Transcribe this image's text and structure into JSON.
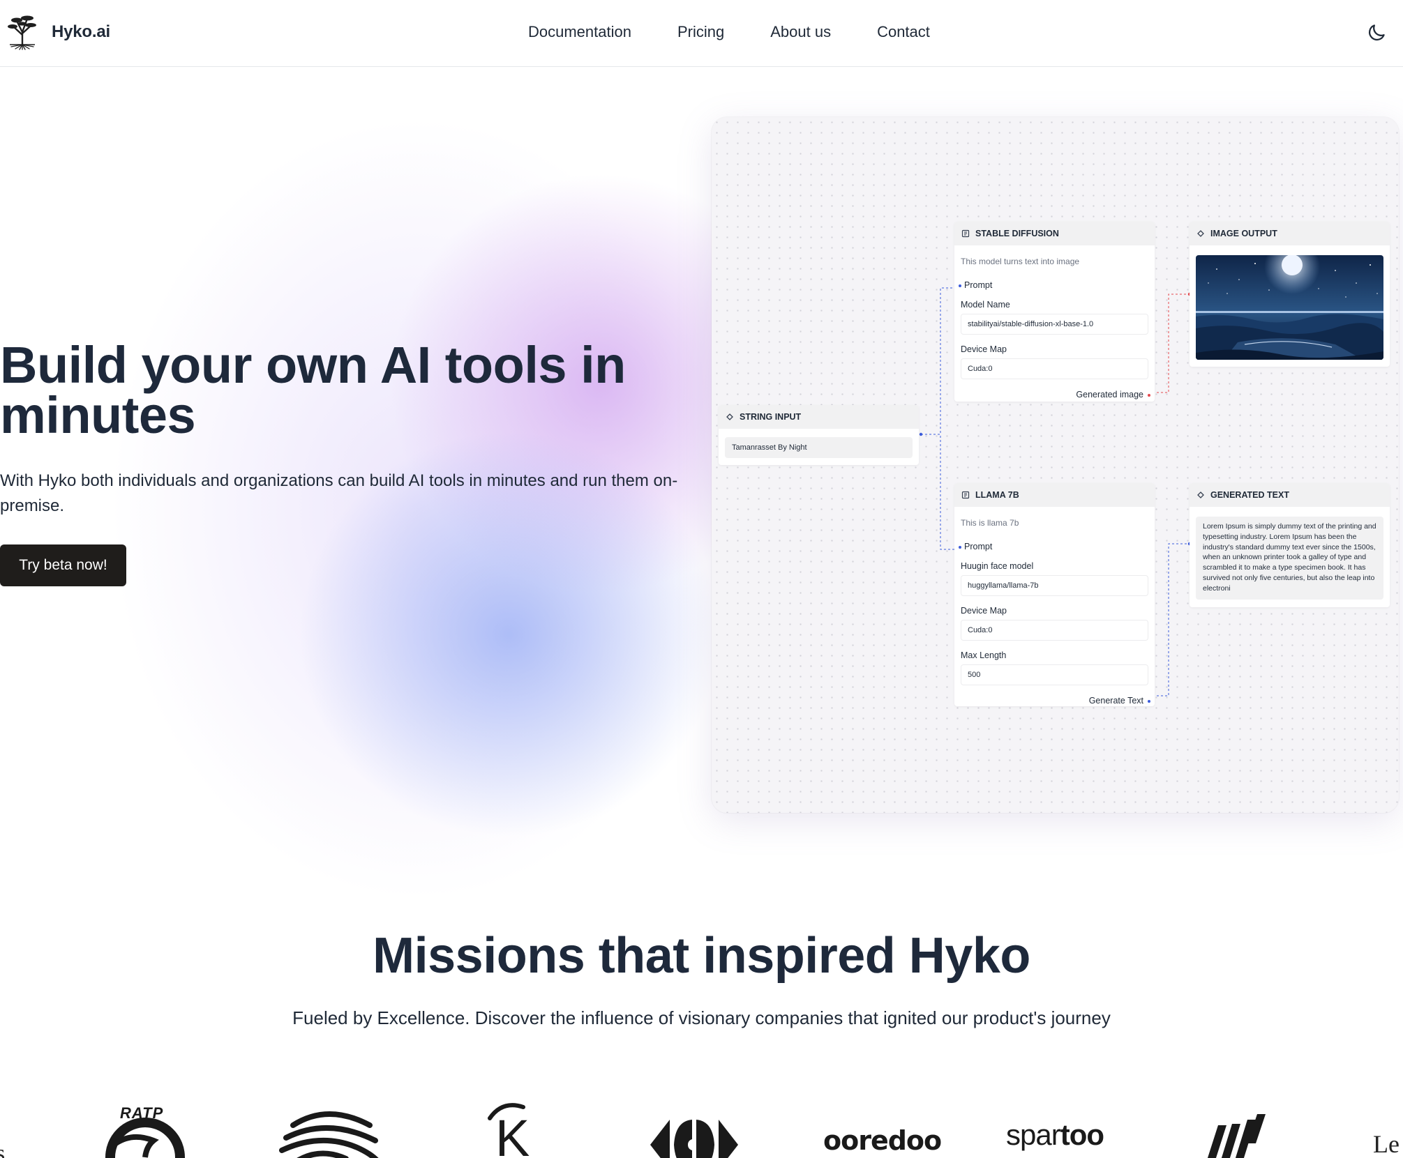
{
  "nav": {
    "brand": "Hyko.ai",
    "links": [
      "Documentation",
      "Pricing",
      "About us",
      "Contact"
    ],
    "theme_toggle_icon": "moon-icon"
  },
  "hero": {
    "title": "Build your own AI tools in minutes",
    "subtitle": "With Hyko both individuals and organizations can build AI tools in minutes and run them on-premise.",
    "cta": "Try beta now!"
  },
  "flow": {
    "string_input": {
      "title": "STRING INPUT",
      "value": "Tamanrasset By Night"
    },
    "stable_diffusion": {
      "title": "STABLE DIFFUSION",
      "description": "This model turns text into image",
      "input_port": "Prompt",
      "fields": [
        {
          "label": "Model Name",
          "value": "stabilityai/stable-diffusion-xl-base-1.0"
        },
        {
          "label": "Device Map",
          "value": "Cuda:0"
        }
      ],
      "output_port": "Generated image"
    },
    "image_output": {
      "title": "IMAGE OUTPUT"
    },
    "llama": {
      "title": "LLAMA 7B",
      "description": "This is llama 7b",
      "input_port": "Prompt",
      "fields": [
        {
          "label": "Huugin face model",
          "value": "huggyllama/llama-7b"
        },
        {
          "label": "Device Map",
          "value": "Cuda:0"
        },
        {
          "label": "Max Length",
          "value": "500"
        }
      ],
      "output_port": "Generate Text"
    },
    "generated_text": {
      "title": "GENERATED TEXT",
      "body": "Lorem Ipsum is simply dummy text of the printing and typesetting industry. Lorem Ipsum has been the industry's standard dummy text ever since the 1500s, when an unknown printer took a galley of type and scrambled it to make a type specimen book. It has survived not only five centuries, but also the leap into electroni"
    },
    "colors": {
      "image_wire": "#e5484d",
      "text_wire": "#3b5bdb"
    }
  },
  "missions": {
    "title": "Missions that inspired Hyko",
    "subtitle": "Fueled by Excellence. Discover the influence of visionary companies that ignited our product's journey",
    "logos": [
      {
        "name": "partial-logo-left",
        "text": "s"
      },
      {
        "name": "ratp-logo",
        "text": "RATP"
      },
      {
        "name": "wave-logo",
        "text": ""
      },
      {
        "name": "k-logo",
        "text": "K"
      },
      {
        "name": "carrefour-logo",
        "text": ""
      },
      {
        "name": "ooredoo-logo",
        "text": "ooredoo"
      },
      {
        "name": "spartoo-logo",
        "text_light": "spar",
        "text_bold": "too"
      },
      {
        "name": "stripes-logo",
        "text": ""
      },
      {
        "name": "partial-logo-right",
        "text": "Le"
      }
    ]
  }
}
